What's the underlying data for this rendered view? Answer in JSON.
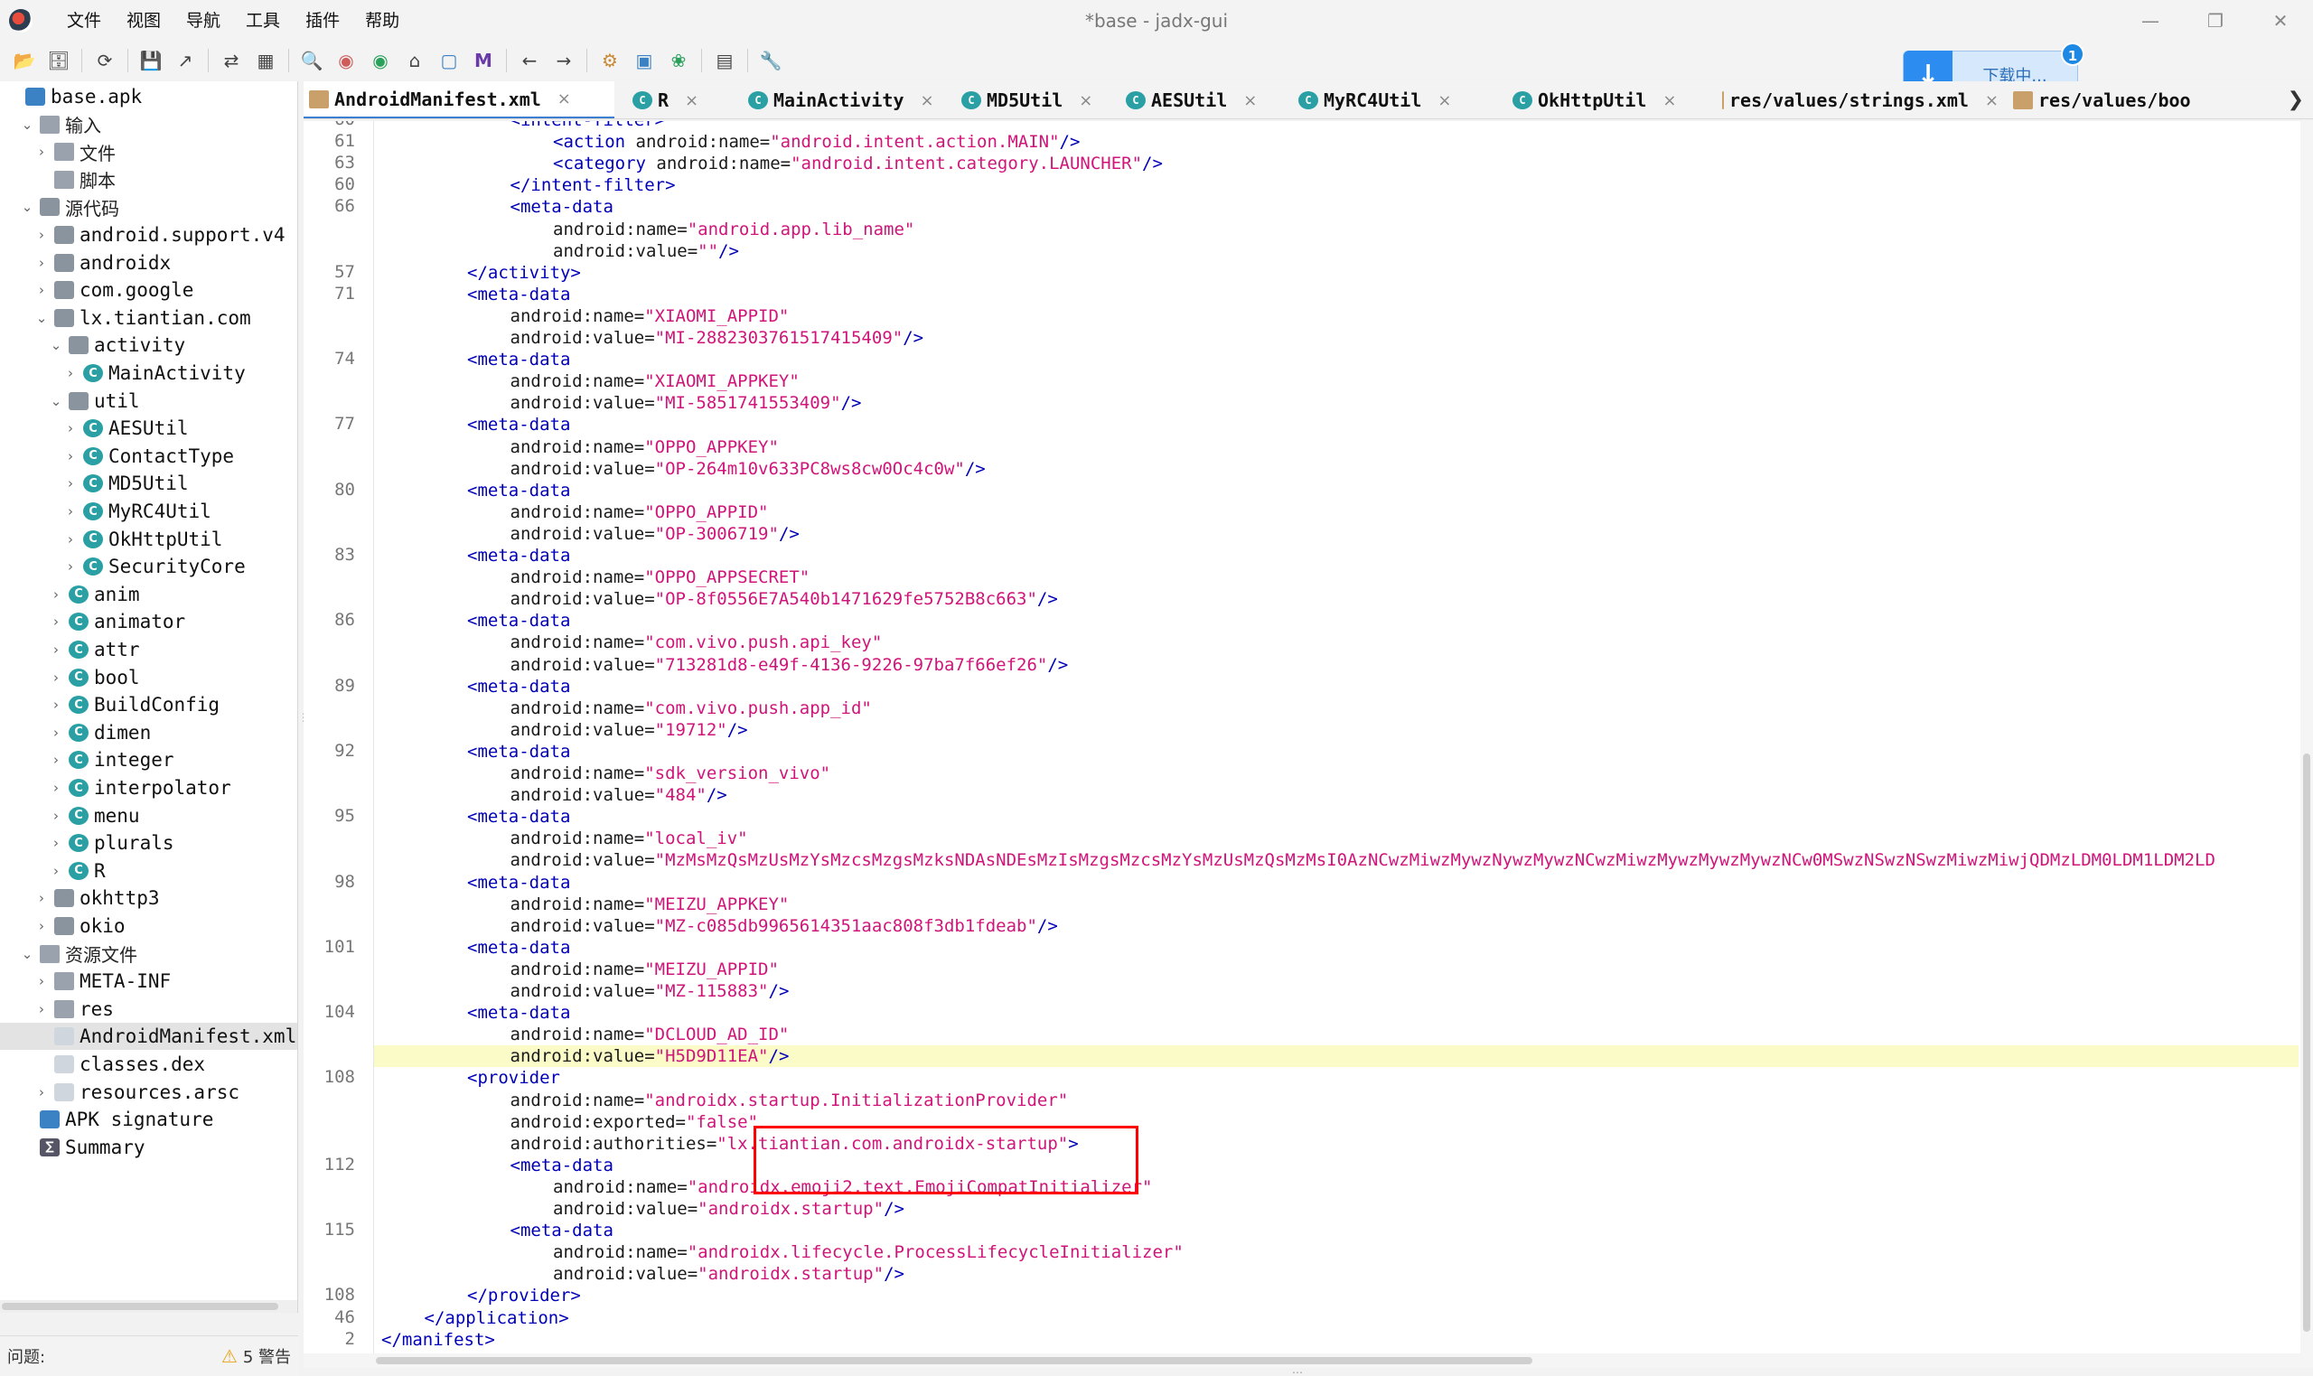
{
  "window": {
    "title": "*base - jadx-gui"
  },
  "menubar": [
    "文件",
    "视图",
    "导航",
    "工具",
    "插件",
    "帮助"
  ],
  "toolbar_icons": [
    "open-folder-icon",
    "add-file-icon",
    "reload-icon",
    "save-icon",
    "export-icon",
    "sync-icon",
    "flatten-icon",
    "search-icon",
    "find-class-icon",
    "find-usage-icon",
    "home-icon",
    "log-icon",
    "quark-icon",
    "back-icon",
    "forward-icon",
    "decompile-icon",
    "deobfuscate-icon",
    "debug-icon",
    "log-viewer-icon",
    "preferences-icon"
  ],
  "download": {
    "label": "下载中...",
    "badge": "1"
  },
  "tree": [
    {
      "label": "base.apk",
      "level": 0,
      "chev": "",
      "icon": "apk",
      "cjk": false
    },
    {
      "label": "输入",
      "level": 1,
      "chev": "v",
      "icon": "folder",
      "cjk": true
    },
    {
      "label": "文件",
      "level": 2,
      "chev": ">",
      "icon": "folder",
      "cjk": true
    },
    {
      "label": "脚本",
      "level": 2,
      "chev": "",
      "icon": "folder",
      "cjk": true
    },
    {
      "label": "源代码",
      "level": 1,
      "chev": "v",
      "icon": "pkg",
      "cjk": true
    },
    {
      "label": "android.support.v4",
      "level": 2,
      "chev": ">",
      "icon": "pkg",
      "cjk": false
    },
    {
      "label": "androidx",
      "level": 2,
      "chev": ">",
      "icon": "pkg",
      "cjk": false
    },
    {
      "label": "com.google",
      "level": 2,
      "chev": ">",
      "icon": "pkg",
      "cjk": false
    },
    {
      "label": "lx.tiantian.com",
      "level": 2,
      "chev": "v",
      "icon": "pkg",
      "cjk": false
    },
    {
      "label": "activity",
      "level": 3,
      "chev": "v",
      "icon": "pkg",
      "cjk": false
    },
    {
      "label": "MainActivity",
      "level": 4,
      "chev": ">",
      "icon": "class",
      "cjk": false
    },
    {
      "label": "util",
      "level": 3,
      "chev": "v",
      "icon": "pkg",
      "cjk": false
    },
    {
      "label": "AESUtil",
      "level": 4,
      "chev": ">",
      "icon": "class",
      "cjk": false
    },
    {
      "label": "ContactType",
      "level": 4,
      "chev": ">",
      "icon": "class",
      "cjk": false
    },
    {
      "label": "MD5Util",
      "level": 4,
      "chev": ">",
      "icon": "class",
      "cjk": false
    },
    {
      "label": "MyRC4Util",
      "level": 4,
      "chev": ">",
      "icon": "class",
      "cjk": false
    },
    {
      "label": "OkHttpUtil",
      "level": 4,
      "chev": ">",
      "icon": "class",
      "cjk": false
    },
    {
      "label": "SecurityCore",
      "level": 4,
      "chev": ">",
      "icon": "class",
      "cjk": false
    },
    {
      "label": "anim",
      "level": 3,
      "chev": ">",
      "icon": "class",
      "cjk": false
    },
    {
      "label": "animator",
      "level": 3,
      "chev": ">",
      "icon": "class",
      "cjk": false
    },
    {
      "label": "attr",
      "level": 3,
      "chev": ">",
      "icon": "class",
      "cjk": false
    },
    {
      "label": "bool",
      "level": 3,
      "chev": ">",
      "icon": "class",
      "cjk": false
    },
    {
      "label": "BuildConfig",
      "level": 3,
      "chev": ">",
      "icon": "class",
      "cjk": false
    },
    {
      "label": "dimen",
      "level": 3,
      "chev": ">",
      "icon": "class",
      "cjk": false
    },
    {
      "label": "integer",
      "level": 3,
      "chev": ">",
      "icon": "class",
      "cjk": false
    },
    {
      "label": "interpolator",
      "level": 3,
      "chev": ">",
      "icon": "class",
      "cjk": false
    },
    {
      "label": "menu",
      "level": 3,
      "chev": ">",
      "icon": "class",
      "cjk": false
    },
    {
      "label": "plurals",
      "level": 3,
      "chev": ">",
      "icon": "class",
      "cjk": false
    },
    {
      "label": "R",
      "level": 3,
      "chev": ">",
      "icon": "class",
      "cjk": false
    },
    {
      "label": "okhttp3",
      "level": 2,
      "chev": ">",
      "icon": "pkg",
      "cjk": false
    },
    {
      "label": "okio",
      "level": 2,
      "chev": ">",
      "icon": "pkg",
      "cjk": false
    },
    {
      "label": "资源文件",
      "level": 1,
      "chev": "v",
      "icon": "folder",
      "cjk": true
    },
    {
      "label": "META-INF",
      "level": 2,
      "chev": ">",
      "icon": "folder",
      "cjk": false
    },
    {
      "label": "res",
      "level": 2,
      "chev": ">",
      "icon": "folder",
      "cjk": false
    },
    {
      "label": "AndroidManifest.xml",
      "level": 2,
      "chev": "",
      "icon": "file",
      "cjk": false,
      "selected": true
    },
    {
      "label": "classes.dex",
      "level": 2,
      "chev": "",
      "icon": "file",
      "cjk": false
    },
    {
      "label": "resources.arsc",
      "level": 2,
      "chev": ">",
      "icon": "file",
      "cjk": false
    },
    {
      "label": "APK signature",
      "level": 1,
      "chev": "",
      "icon": "apk",
      "cjk": false
    },
    {
      "label": "Summary",
      "level": 1,
      "chev": "",
      "icon": "sum",
      "cjk": false
    }
  ],
  "status": {
    "issues": "问题:",
    "warnings": "5 警告"
  },
  "tabs": [
    {
      "label": "AndroidManifest.xml",
      "type": "xml",
      "active": true
    },
    {
      "label": "R",
      "type": "class"
    },
    {
      "label": "MainActivity",
      "type": "class"
    },
    {
      "label": "MD5Util",
      "type": "class"
    },
    {
      "label": "AESUtil",
      "type": "class"
    },
    {
      "label": "MyRC4Util",
      "type": "class"
    },
    {
      "label": "OkHttpUtil",
      "type": "class"
    },
    {
      "label": "res/values/strings.xml",
      "type": "xml"
    },
    {
      "label": "res/values/boo",
      "type": "xml"
    }
  ],
  "code_lines": [
    {
      "ln": "60",
      "indent": 3,
      "parts": [
        [
          "tag",
          "<intent-filter>"
        ]
      ]
    },
    {
      "ln": "61",
      "indent": 4,
      "parts": [
        [
          "tag",
          "<action "
        ],
        [
          "attr",
          "android:name="
        ],
        [
          "val",
          "\"android.intent.action.MAIN\""
        ],
        [
          "tag",
          "/>"
        ]
      ]
    },
    {
      "ln": "63",
      "indent": 4,
      "parts": [
        [
          "tag",
          "<category "
        ],
        [
          "attr",
          "android:name="
        ],
        [
          "val",
          "\"android.intent.category.LAUNCHER\""
        ],
        [
          "tag",
          "/>"
        ]
      ]
    },
    {
      "ln": "60",
      "indent": 3,
      "parts": [
        [
          "tag",
          "</intent-filter>"
        ]
      ]
    },
    {
      "ln": "66",
      "indent": 3,
      "parts": [
        [
          "tag",
          "<meta-data"
        ]
      ]
    },
    {
      "ln": "",
      "indent": 4,
      "parts": [
        [
          "attr",
          "android:name="
        ],
        [
          "val",
          "\"android.app.lib_name\""
        ]
      ]
    },
    {
      "ln": "",
      "indent": 4,
      "parts": [
        [
          "attr",
          "android:value="
        ],
        [
          "val",
          "\"\""
        ],
        [
          "tag",
          "/>"
        ]
      ]
    },
    {
      "ln": "57",
      "indent": 2,
      "parts": [
        [
          "tag",
          "</activity>"
        ]
      ]
    },
    {
      "ln": "71",
      "indent": 2,
      "parts": [
        [
          "tag",
          "<meta-data"
        ]
      ]
    },
    {
      "ln": "",
      "indent": 3,
      "parts": [
        [
          "attr",
          "android:name="
        ],
        [
          "val",
          "\"XIAOMI_APPID\""
        ]
      ]
    },
    {
      "ln": "",
      "indent": 3,
      "parts": [
        [
          "attr",
          "android:value="
        ],
        [
          "val",
          "\"MI-2882303761517415409\""
        ],
        [
          "tag",
          "/>"
        ]
      ]
    },
    {
      "ln": "74",
      "indent": 2,
      "parts": [
        [
          "tag",
          "<meta-data"
        ]
      ]
    },
    {
      "ln": "",
      "indent": 3,
      "parts": [
        [
          "attr",
          "android:name="
        ],
        [
          "val",
          "\"XIAOMI_APPKEY\""
        ]
      ]
    },
    {
      "ln": "",
      "indent": 3,
      "parts": [
        [
          "attr",
          "android:value="
        ],
        [
          "val",
          "\"MI-5851741553409\""
        ],
        [
          "tag",
          "/>"
        ]
      ]
    },
    {
      "ln": "77",
      "indent": 2,
      "parts": [
        [
          "tag",
          "<meta-data"
        ]
      ]
    },
    {
      "ln": "",
      "indent": 3,
      "parts": [
        [
          "attr",
          "android:name="
        ],
        [
          "val",
          "\"OPPO_APPKEY\""
        ]
      ]
    },
    {
      "ln": "",
      "indent": 3,
      "parts": [
        [
          "attr",
          "android:value="
        ],
        [
          "val",
          "\"OP-264m10v633PC8ws8cw0Oc4c0w\""
        ],
        [
          "tag",
          "/>"
        ]
      ]
    },
    {
      "ln": "80",
      "indent": 2,
      "parts": [
        [
          "tag",
          "<meta-data"
        ]
      ]
    },
    {
      "ln": "",
      "indent": 3,
      "parts": [
        [
          "attr",
          "android:name="
        ],
        [
          "val",
          "\"OPPO_APPID\""
        ]
      ]
    },
    {
      "ln": "",
      "indent": 3,
      "parts": [
        [
          "attr",
          "android:value="
        ],
        [
          "val",
          "\"OP-3006719\""
        ],
        [
          "tag",
          "/>"
        ]
      ]
    },
    {
      "ln": "83",
      "indent": 2,
      "parts": [
        [
          "tag",
          "<meta-data"
        ]
      ]
    },
    {
      "ln": "",
      "indent": 3,
      "parts": [
        [
          "attr",
          "android:name="
        ],
        [
          "val",
          "\"OPPO_APPSECRET\""
        ]
      ]
    },
    {
      "ln": "",
      "indent": 3,
      "parts": [
        [
          "attr",
          "android:value="
        ],
        [
          "val",
          "\"OP-8f0556E7A540b1471629fe5752B8c663\""
        ],
        [
          "tag",
          "/>"
        ]
      ]
    },
    {
      "ln": "86",
      "indent": 2,
      "parts": [
        [
          "tag",
          "<meta-data"
        ]
      ]
    },
    {
      "ln": "",
      "indent": 3,
      "parts": [
        [
          "attr",
          "android:name="
        ],
        [
          "val",
          "\"com.vivo.push.api_key\""
        ]
      ]
    },
    {
      "ln": "",
      "indent": 3,
      "parts": [
        [
          "attr",
          "android:value="
        ],
        [
          "val",
          "\"713281d8-e49f-4136-9226-97ba7f66ef26\""
        ],
        [
          "tag",
          "/>"
        ]
      ]
    },
    {
      "ln": "89",
      "indent": 2,
      "parts": [
        [
          "tag",
          "<meta-data"
        ]
      ]
    },
    {
      "ln": "",
      "indent": 3,
      "parts": [
        [
          "attr",
          "android:name="
        ],
        [
          "val",
          "\"com.vivo.push.app_id\""
        ]
      ]
    },
    {
      "ln": "",
      "indent": 3,
      "parts": [
        [
          "attr",
          "android:value="
        ],
        [
          "val",
          "\"19712\""
        ],
        [
          "tag",
          "/>"
        ]
      ]
    },
    {
      "ln": "92",
      "indent": 2,
      "parts": [
        [
          "tag",
          "<meta-data"
        ]
      ]
    },
    {
      "ln": "",
      "indent": 3,
      "parts": [
        [
          "attr",
          "android:name="
        ],
        [
          "val",
          "\"sdk_version_vivo\""
        ]
      ]
    },
    {
      "ln": "",
      "indent": 3,
      "parts": [
        [
          "attr",
          "android:value="
        ],
        [
          "val",
          "\"484\""
        ],
        [
          "tag",
          "/>"
        ]
      ]
    },
    {
      "ln": "95",
      "indent": 2,
      "parts": [
        [
          "tag",
          "<meta-data"
        ]
      ]
    },
    {
      "ln": "",
      "indent": 3,
      "parts": [
        [
          "attr",
          "android:name="
        ],
        [
          "val",
          "\"local_iv\""
        ]
      ]
    },
    {
      "ln": "",
      "indent": 3,
      "parts": [
        [
          "attr",
          "android:value="
        ],
        [
          "val",
          "\"MzMsMzQsMzUsMzYsMzcsMzgsMzksNDAsNDEsMzIsMzgsMzcsMzYsMzUsMzQsMzMsI0AzNCwzMiwzMywzNywzMywzNCwzMiwzMywzMywzMywzNCw0MSwzNSwzNSwzMiwzMiwjQDMzLDM0LDM1LDM2LD"
        ]
      ]
    },
    {
      "ln": "98",
      "indent": 2,
      "parts": [
        [
          "tag",
          "<meta-data"
        ]
      ]
    },
    {
      "ln": "",
      "indent": 3,
      "parts": [
        [
          "attr",
          "android:name="
        ],
        [
          "val",
          "\"MEIZU_APPKEY\""
        ]
      ]
    },
    {
      "ln": "",
      "indent": 3,
      "parts": [
        [
          "attr",
          "android:value="
        ],
        [
          "val",
          "\"MZ-c085db9965614351aac808f3db1fdeab\""
        ],
        [
          "tag",
          "/>"
        ]
      ]
    },
    {
      "ln": "101",
      "indent": 2,
      "parts": [
        [
          "tag",
          "<meta-data"
        ]
      ]
    },
    {
      "ln": "",
      "indent": 3,
      "parts": [
        [
          "attr",
          "android:name="
        ],
        [
          "val",
          "\"MEIZU_APPID\""
        ]
      ]
    },
    {
      "ln": "",
      "indent": 3,
      "parts": [
        [
          "attr",
          "android:value="
        ],
        [
          "val",
          "\"MZ-115883\""
        ],
        [
          "tag",
          "/>"
        ]
      ]
    },
    {
      "ln": "104",
      "indent": 2,
      "parts": [
        [
          "tag",
          "<meta-data"
        ]
      ]
    },
    {
      "ln": "",
      "indent": 3,
      "parts": [
        [
          "attr",
          "android:name="
        ],
        [
          "val",
          "\"DCLOUD_AD_ID\""
        ]
      ]
    },
    {
      "ln": "",
      "indent": 3,
      "parts": [
        [
          "attr",
          "android:value="
        ],
        [
          "val",
          "\"H5D9D11EA\""
        ],
        [
          "tag",
          "/>"
        ]
      ],
      "highlight": true
    },
    {
      "ln": "108",
      "indent": 2,
      "parts": [
        [
          "tag",
          "<provider"
        ]
      ]
    },
    {
      "ln": "",
      "indent": 3,
      "parts": [
        [
          "attr",
          "android:name="
        ],
        [
          "val",
          "\"androidx.startup.InitializationProvider\""
        ]
      ]
    },
    {
      "ln": "",
      "indent": 3,
      "parts": [
        [
          "attr",
          "android:exported="
        ],
        [
          "val",
          "\"false\""
        ]
      ]
    },
    {
      "ln": "",
      "indent": 3,
      "parts": [
        [
          "attr",
          "android:authorities="
        ],
        [
          "val",
          "\"lx.tiantian.com.androidx-startup\""
        ],
        [
          "tag",
          ">"
        ]
      ]
    },
    {
      "ln": "112",
      "indent": 3,
      "parts": [
        [
          "tag",
          "<meta-data"
        ]
      ]
    },
    {
      "ln": "",
      "indent": 4,
      "parts": [
        [
          "attr",
          "android:name="
        ],
        [
          "val",
          "\"androidx.emoji2.text.EmojiCompatInitializer\""
        ]
      ]
    },
    {
      "ln": "",
      "indent": 4,
      "parts": [
        [
          "attr",
          "android:value="
        ],
        [
          "val",
          "\"androidx.startup\""
        ],
        [
          "tag",
          "/>"
        ]
      ]
    },
    {
      "ln": "115",
      "indent": 3,
      "parts": [
        [
          "tag",
          "<meta-data"
        ]
      ]
    },
    {
      "ln": "",
      "indent": 4,
      "parts": [
        [
          "attr",
          "android:name="
        ],
        [
          "val",
          "\"androidx.lifecycle.ProcessLifecycleInitializer\""
        ]
      ]
    },
    {
      "ln": "",
      "indent": 4,
      "parts": [
        [
          "attr",
          "android:value="
        ],
        [
          "val",
          "\"androidx.startup\""
        ],
        [
          "tag",
          "/>"
        ]
      ]
    },
    {
      "ln": "108",
      "indent": 2,
      "parts": [
        [
          "tag",
          "</provider>"
        ]
      ]
    },
    {
      "ln": "46",
      "indent": 1,
      "parts": [
        [
          "tag",
          "</application>"
        ]
      ]
    },
    {
      "ln": "2",
      "indent": 0,
      "parts": [
        [
          "tag",
          "</manifest>"
        ]
      ]
    }
  ],
  "colors": {
    "tag": "#0000b8",
    "value": "#d0157a",
    "highlight_line": "#fbfbc8",
    "annotation_box": "#ff0000"
  }
}
